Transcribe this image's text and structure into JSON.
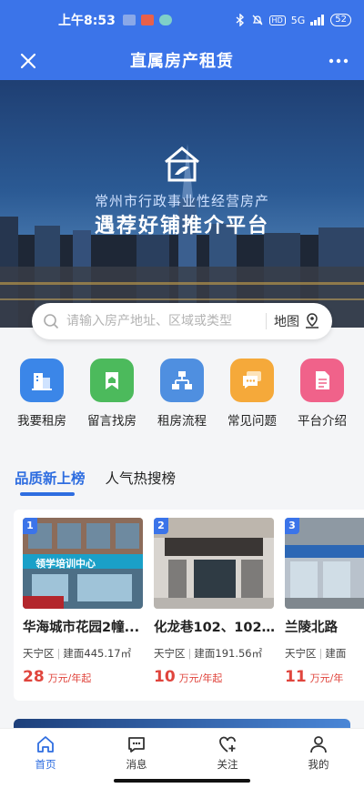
{
  "status_bar": {
    "time": "上午8:53",
    "network": "5G",
    "battery": "52"
  },
  "header": {
    "title": "直属房产租赁"
  },
  "banner": {
    "subtitle": "常州市行政事业性经营房产",
    "headline": "遇荐好铺推介平台"
  },
  "search": {
    "placeholder": "请输入房产地址、区域或类型",
    "map_label": "地图"
  },
  "quick_links": [
    {
      "label": "我要租房",
      "icon": "building-icon",
      "color": "#3b86e8"
    },
    {
      "label": "留言找房",
      "icon": "house-bookmark-icon",
      "color": "#4cba5c"
    },
    {
      "label": "租房流程",
      "icon": "flowchart-icon",
      "color": "#4f8fe0"
    },
    {
      "label": "常见问题",
      "icon": "chat-bubbles-icon",
      "color": "#f5a93a"
    },
    {
      "label": "平台介绍",
      "icon": "document-icon",
      "color": "#f0628a"
    }
  ],
  "tabs": [
    {
      "label": "品质新上榜",
      "active": true
    },
    {
      "label": "人气热搜榜",
      "active": false
    }
  ],
  "listings": [
    {
      "rank": "1",
      "title": "华海城市花园2幢...",
      "district": "天宁区",
      "area": "建面445.17㎡",
      "price": "28",
      "price_unit": "万元/年起",
      "photo_sign": "领学培训中心"
    },
    {
      "rank": "2",
      "title": "化龙巷102、102...",
      "district": "天宁区",
      "area": "建面191.56㎡",
      "price": "10",
      "price_unit": "万元/年起"
    },
    {
      "rank": "3",
      "title": "兰陵北路",
      "district": "天宁区",
      "area": "建面",
      "price": "11",
      "price_unit": "万元/年"
    }
  ],
  "bottom_nav": [
    {
      "label": "首页",
      "icon": "home-icon",
      "active": true
    },
    {
      "label": "消息",
      "icon": "message-icon",
      "active": false
    },
    {
      "label": "关注",
      "icon": "heart-plus-icon",
      "active": false
    },
    {
      "label": "我的",
      "icon": "user-icon",
      "active": false
    }
  ]
}
